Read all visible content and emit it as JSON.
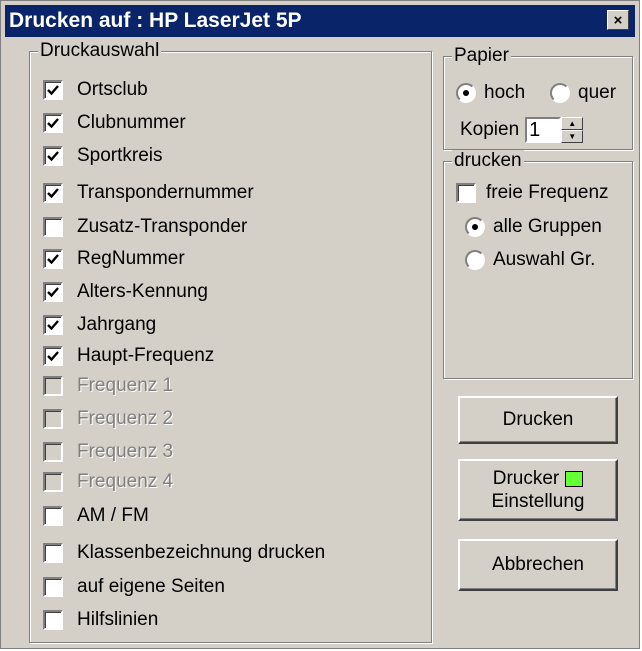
{
  "window": {
    "title": "Drucken auf : HP LaserJet 5P",
    "close_glyph": "×"
  },
  "druckauswahl": {
    "label": "Druckauswahl",
    "items": [
      {
        "label": "Ortsclub",
        "checked": true,
        "enabled": true
      },
      {
        "label": "Clubnummer",
        "checked": true,
        "enabled": true
      },
      {
        "label": "Sportkreis",
        "checked": true,
        "enabled": true
      },
      {
        "label": "Transpondernummer",
        "checked": true,
        "enabled": true
      },
      {
        "label": "Zusatz-Transponder",
        "checked": false,
        "enabled": true
      },
      {
        "label": "RegNummer",
        "checked": true,
        "enabled": true
      },
      {
        "label": "Alters-Kennung",
        "checked": true,
        "enabled": true
      },
      {
        "label": "Jahrgang",
        "checked": true,
        "enabled": true
      },
      {
        "label": "Haupt-Frequenz",
        "checked": true,
        "enabled": true
      },
      {
        "label": "Frequenz 1",
        "checked": false,
        "enabled": false
      },
      {
        "label": "Frequenz 2",
        "checked": false,
        "enabled": false
      },
      {
        "label": "Frequenz 3",
        "checked": false,
        "enabled": false
      },
      {
        "label": "Frequenz 4",
        "checked": false,
        "enabled": false
      },
      {
        "label": "AM / FM",
        "checked": false,
        "enabled": true
      },
      {
        "label": "Klassenbezeichnung drucken",
        "checked": false,
        "enabled": true
      },
      {
        "label": "auf eigene Seiten",
        "checked": false,
        "enabled": true
      },
      {
        "label": "Hilfslinien",
        "checked": false,
        "enabled": true
      }
    ]
  },
  "papier": {
    "label": "Papier",
    "orientation": [
      {
        "label": "hoch",
        "selected": true
      },
      {
        "label": "quer",
        "selected": false
      }
    ],
    "kopien_label": "Kopien",
    "kopien_value": "1"
  },
  "drucken_group": {
    "label": "drucken",
    "freie_frequenz": {
      "label": "freie Frequenz",
      "checked": false
    },
    "radios": [
      {
        "label": "alle Gruppen",
        "selected": true
      },
      {
        "label": "Auswahl Gr.",
        "selected": false
      }
    ]
  },
  "buttons": {
    "drucken": "Drucken",
    "drucker_line1": "Drucker",
    "drucker_line2": "Einstellung",
    "abbrechen": "Abbrechen"
  },
  "colors": {
    "titlebar": "#0a246a",
    "dialog_bg": "#d4d0c8",
    "indicator": "#66ff33"
  }
}
